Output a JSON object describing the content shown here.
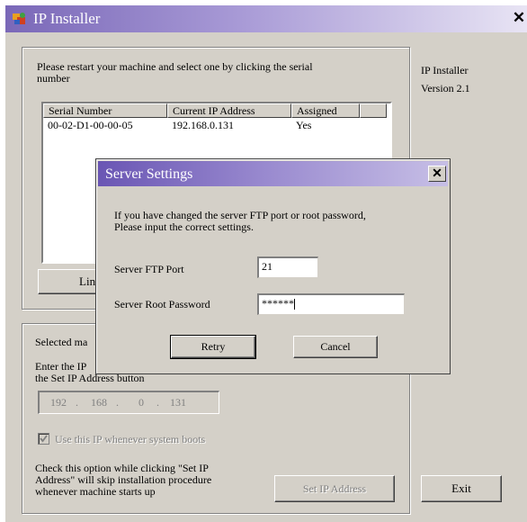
{
  "window": {
    "title": "IP Installer",
    "close_glyph": "✕"
  },
  "main": {
    "instruction": "Please restart your machine and select one by clicking the serial number",
    "info_line1": "IP Installer",
    "info_line2": "Version 2.1",
    "list": {
      "columns": [
        "Serial Number",
        "Current IP Address",
        "Assigned"
      ],
      "rows": [
        [
          "00-02-D1-00-00-05",
          "192.168.0.131",
          "Yes"
        ]
      ]
    },
    "link_button_label": "Link to",
    "selected_label": "Selected ma",
    "enter_ip_line1": "Enter the IP",
    "enter_ip_line2": "the Set IP Address button",
    "ip": [
      "192",
      "168",
      "0",
      "131"
    ],
    "use_ip_checkbox_label": "Use this IP whenever system boots",
    "use_ip_checked": true,
    "hint_line1": "Check this option while clicking \"Set IP",
    "hint_line2": "Address\" will skip installation procedure",
    "hint_line3": "whenever machine starts up",
    "set_ip_button_label": "Set IP Address",
    "exit_button_label": "Exit"
  },
  "dialog": {
    "title": "Server Settings",
    "close_glyph": "✕",
    "message_line1": "If you have changed the server FTP port or root password,",
    "message_line2": "Please input the correct settings.",
    "ftp_port_label": "Server FTP Port",
    "ftp_port_value": "21",
    "root_password_label": "Server Root Password",
    "root_password_value": "******",
    "retry_label": "Retry",
    "cancel_label": "Cancel"
  },
  "colors": {
    "title_gradient_start": "#7a68b8",
    "dialog_gradient_start": "#6a56b4",
    "face": "#d4d0c8"
  }
}
